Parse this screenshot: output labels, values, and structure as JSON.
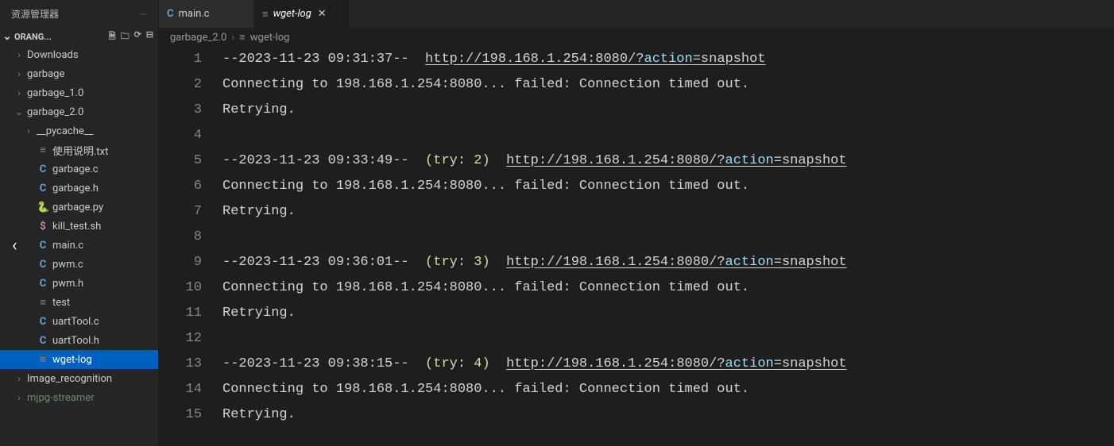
{
  "sidebar": {
    "header_title": "资源管理器",
    "dots": "···",
    "root_name": "ORANG...",
    "items": [
      {
        "kind": "dir",
        "label": "Downloads",
        "arrow": "›",
        "icon": "",
        "depth": 1
      },
      {
        "kind": "dir",
        "label": "garbage",
        "arrow": "›",
        "icon": "",
        "depth": 1
      },
      {
        "kind": "dir",
        "label": "garbage_1.0",
        "arrow": "›",
        "icon": "",
        "depth": 1
      },
      {
        "kind": "dir",
        "label": "garbage_2.0",
        "arrow": "⌄",
        "icon": "",
        "depth": 1
      },
      {
        "kind": "dir",
        "label": "__pycache__",
        "arrow": "›",
        "icon": "",
        "depth": 2
      },
      {
        "kind": "file",
        "label": "使用说明.txt",
        "iconcls": "icon-txt",
        "icon": "≡",
        "depth": 2
      },
      {
        "kind": "file",
        "label": "garbage.c",
        "iconcls": "icon-c",
        "icon": "C",
        "depth": 2
      },
      {
        "kind": "file",
        "label": "garbage.h",
        "iconcls": "icon-c",
        "icon": "C",
        "depth": 2
      },
      {
        "kind": "file",
        "label": "garbage.py",
        "iconcls": "icon-py",
        "icon": "🐍",
        "depth": 2
      },
      {
        "kind": "file",
        "label": "kill_test.sh",
        "iconcls": "icon-sh",
        "icon": "$",
        "depth": 2
      },
      {
        "kind": "file",
        "label": "main.c",
        "iconcls": "icon-c",
        "icon": "C",
        "depth": 2
      },
      {
        "kind": "file",
        "label": "pwm.c",
        "iconcls": "icon-c",
        "icon": "C",
        "depth": 2
      },
      {
        "kind": "file",
        "label": "pwm.h",
        "iconcls": "icon-c",
        "icon": "C",
        "depth": 2
      },
      {
        "kind": "file",
        "label": "test",
        "iconcls": "icon-txt",
        "icon": "≡",
        "depth": 2
      },
      {
        "kind": "file",
        "label": "uartTool.c",
        "iconcls": "icon-c",
        "icon": "C",
        "depth": 2
      },
      {
        "kind": "file",
        "label": "uartTool.h",
        "iconcls": "icon-c",
        "icon": "C",
        "depth": 2
      },
      {
        "kind": "file",
        "label": "wget-log",
        "iconcls": "icon-txt",
        "icon": "≡",
        "depth": 2,
        "selected": true
      },
      {
        "kind": "dir",
        "label": "Image_recognition",
        "arrow": "›",
        "icon": "",
        "depth": 1
      },
      {
        "kind": "dir",
        "label": "mjpg-streamer",
        "arrow": "›",
        "icon": "",
        "depth": 1,
        "dim": true
      }
    ],
    "actions": {
      "new_file": "🗎",
      "new_folder": "🗀",
      "refresh": "⟳",
      "collapse": "⊟"
    }
  },
  "tabs": [
    {
      "icon": "C",
      "iconcls": "icon-c",
      "label": "main.c",
      "active": false
    },
    {
      "icon": "≡",
      "iconcls": "icon-txt",
      "label": "wget-log",
      "active": true
    }
  ],
  "breadcrumbs": {
    "segments": [
      "garbage_2.0",
      "wget-log"
    ],
    "icon": "≡"
  },
  "editor": {
    "url_prefix": "http://198.168.1.254:8080/?",
    "url_param": "action",
    "url_suffix": "=snapshot",
    "conn_line": "Connecting to 198.168.1.254:8080... failed: Connection timed out.",
    "retry_line": "Retrying.",
    "entries": [
      {
        "ts": "--2023-11-23 09:31:37--",
        "try": null
      },
      {
        "ts": "--2023-11-23 09:33:49--",
        "try": "(try: 2)"
      },
      {
        "ts": "--2023-11-23 09:36:01--",
        "try": "(try: 3)"
      },
      {
        "ts": "--2023-11-23 09:38:15--",
        "try": "(try: 4)"
      }
    ],
    "visible_line_count": 15
  },
  "close_glyph": "✕"
}
